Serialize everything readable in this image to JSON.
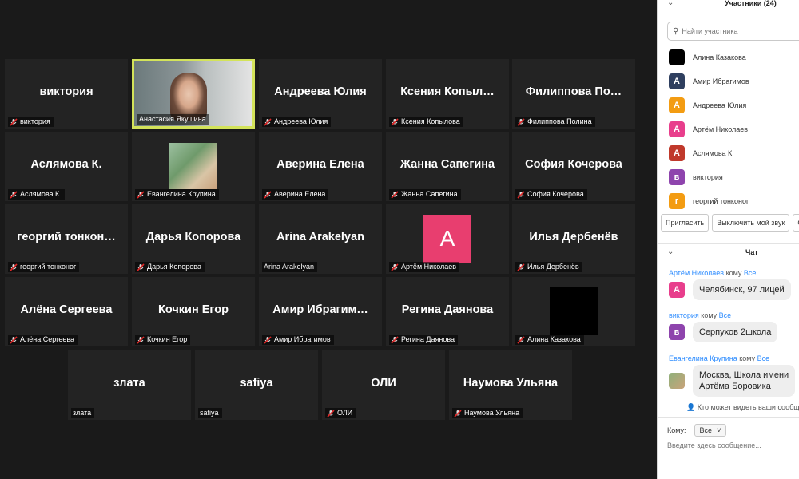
{
  "gallery": {
    "tiles": [
      {
        "big": "виктория",
        "cap": "виктория",
        "muted": true
      },
      {
        "big": "",
        "cap": "Анастасия Якушина",
        "muted": false
      },
      {
        "big": "Андреева Юлия",
        "cap": "Андреева Юлия",
        "muted": true
      },
      {
        "big": "Ксения  Копыл…",
        "cap": "Ксения Копылова",
        "muted": true
      },
      {
        "big": "Филиппова  По…",
        "cap": "Филиппова Полина",
        "muted": true
      },
      {
        "big": "Аслямова К.",
        "cap": "Аслямова К.",
        "muted": true
      },
      {
        "big": "",
        "cap": "Евангелина Крупина",
        "muted": true
      },
      {
        "big": "Аверина Елена",
        "cap": "Аверина Елена",
        "muted": true
      },
      {
        "big": "Жанна Сапегина",
        "cap": "Жанна Сапегина",
        "muted": true
      },
      {
        "big": "София Кочерова",
        "cap": "София Кочерова",
        "muted": true
      },
      {
        "big": "георгий тонкон…",
        "cap": "георгий тонконог",
        "muted": true
      },
      {
        "big": "Дарья Копорова",
        "cap": "Дарья Копорова",
        "muted": true
      },
      {
        "big": "Arina Arakelyan",
        "cap": "Arina Arakelyan",
        "muted": false
      },
      {
        "big": "",
        "cap": "Артём Николаев",
        "muted": true,
        "letter": "A"
      },
      {
        "big": "Илья Дербенёв",
        "cap": "Илья Дербенёв",
        "muted": true
      },
      {
        "big": "Алёна Сергеева",
        "cap": "Алёна Сергеева",
        "muted": true
      },
      {
        "big": "Кочкин Егор",
        "cap": "Кочкин Егор",
        "muted": true
      },
      {
        "big": "Амир Ибрагим…",
        "cap": "Амир Ибрагимов",
        "muted": true
      },
      {
        "big": "Регина Даянова",
        "cap": "Регина Даянова",
        "muted": true
      },
      {
        "big": "",
        "cap": "Алина Казакова",
        "muted": true
      },
      {
        "big": "злата",
        "cap": "злата",
        "muted": false
      },
      {
        "big": "safiya",
        "cap": "safiya",
        "muted": false
      },
      {
        "big": "ОЛИ",
        "cap": "ОЛИ",
        "muted": true
      },
      {
        "big": "Наумова Ульяна",
        "cap": "Наумова Ульяна",
        "muted": true
      }
    ]
  },
  "participants": {
    "title": "Участники (24)",
    "search_placeholder": "Найти участника",
    "list": [
      {
        "name": "Алина Казакова",
        "letter": "",
        "color": "#000000"
      },
      {
        "name": "Амир Ибрагимов",
        "letter": "А",
        "color": "#2f3f5f"
      },
      {
        "name": "Андреева Юлия",
        "letter": "А",
        "color": "#f39c12"
      },
      {
        "name": "Артём Николаев",
        "letter": "А",
        "color": "#e83e8c"
      },
      {
        "name": "Аслямова К.",
        "letter": "А",
        "color": "#c0392b"
      },
      {
        "name": "виктория",
        "letter": "в",
        "color": "#8e44ad"
      },
      {
        "name": "георгий тонконог",
        "letter": "г",
        "color": "#f39c12"
      }
    ],
    "buttons": [
      "Пригласить",
      "Выключить мой звук",
      "Стат"
    ]
  },
  "chat": {
    "title": "Чат",
    "to_word": "кому",
    "everyone": "Все",
    "messages": [
      {
        "name": "Артём Николаев",
        "text": "Челябинск, 97 лицей",
        "letter": "А",
        "color": "#e83e8c"
      },
      {
        "name": "виктория",
        "text": "Серпухов 2школа",
        "letter": "в",
        "color": "#8e44ad"
      },
      {
        "name": "Евангелина Крупина",
        "text_line1": "Москва, Школа имени",
        "text_line2": "Артёма Боровика",
        "letter": "",
        "color": "#6a8f5a"
      }
    ],
    "who_sees": "Кто может видеть ваши сообщ",
    "to_label": "Кому:",
    "to_value": "Все",
    "input_placeholder": "Введите здесь сообщение..."
  }
}
